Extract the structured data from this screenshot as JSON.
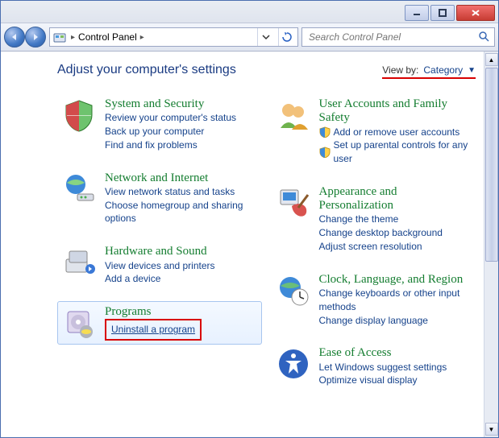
{
  "breadcrumb": {
    "text": "Control Panel"
  },
  "search": {
    "placeholder": "Search Control Panel"
  },
  "header": {
    "title": "Adjust your computer's settings",
    "viewby_label": "View by:",
    "viewby_value": "Category"
  },
  "left": [
    {
      "title": "System and Security",
      "links": [
        {
          "text": "Review your computer's status"
        },
        {
          "text": "Back up your computer"
        },
        {
          "text": "Find and fix problems"
        }
      ]
    },
    {
      "title": "Network and Internet",
      "links": [
        {
          "text": "View network status and tasks"
        },
        {
          "text": "Choose homegroup and sharing options"
        }
      ]
    },
    {
      "title": "Hardware and Sound",
      "links": [
        {
          "text": "View devices and printers"
        },
        {
          "text": "Add a device"
        }
      ]
    },
    {
      "title": "Programs",
      "highlight": true,
      "links": [
        {
          "text": "Uninstall a program",
          "boxed": true
        }
      ]
    }
  ],
  "right": [
    {
      "title": "User Accounts and Family Safety",
      "links": [
        {
          "text": "Add or remove user accounts",
          "shield": true
        },
        {
          "text": "Set up parental controls for any user",
          "shield": true
        }
      ]
    },
    {
      "title": "Appearance and Personalization",
      "links": [
        {
          "text": "Change the theme"
        },
        {
          "text": "Change desktop background"
        },
        {
          "text": "Adjust screen resolution"
        }
      ]
    },
    {
      "title": "Clock, Language, and Region",
      "links": [
        {
          "text": "Change keyboards or other input methods"
        },
        {
          "text": "Change display language"
        }
      ]
    },
    {
      "title": "Ease of Access",
      "links": [
        {
          "text": "Let Windows suggest settings"
        },
        {
          "text": "Optimize visual display"
        }
      ]
    }
  ]
}
